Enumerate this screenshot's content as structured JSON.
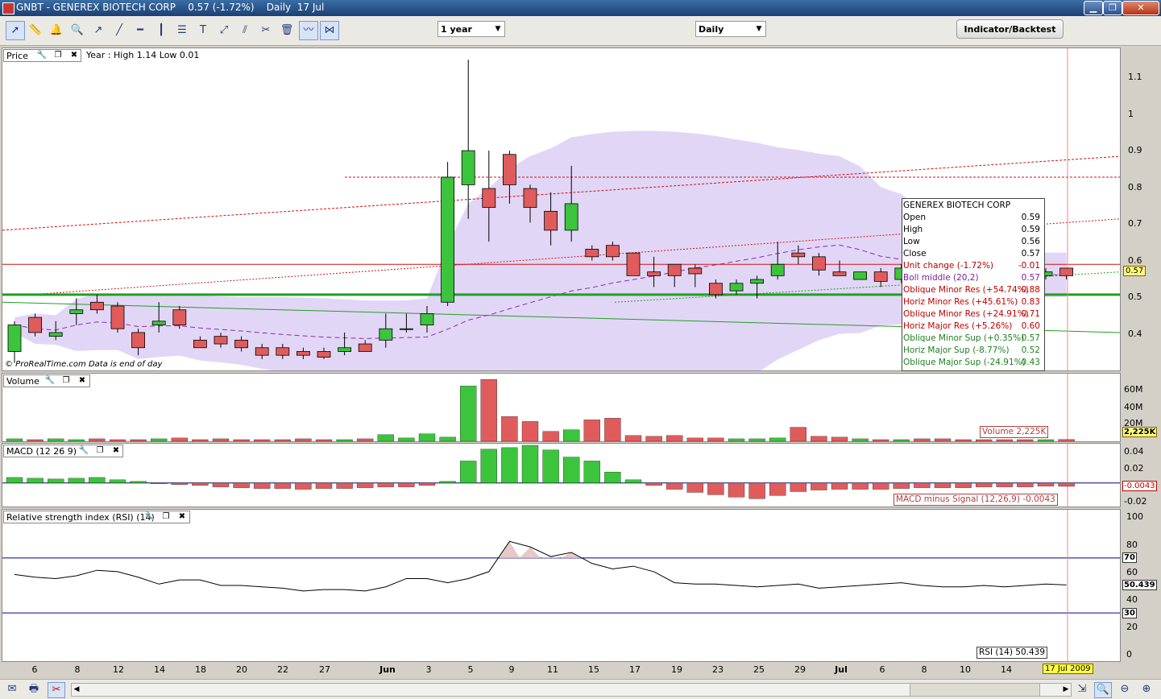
{
  "window": {
    "title": "GNBT - GENEREX BIOTECH CORP    0.57 (-1.72%)    Daily  17 Jul",
    "buttons": [
      "minimize",
      "restore",
      "close"
    ]
  },
  "toolbar": {
    "tools": [
      "pointer-icon",
      "ruler-icon",
      "alert-bell-icon",
      "zoom-icon",
      "line-icon",
      "trendline-icon",
      "horizontal-line-icon",
      "vertical-line-icon",
      "fibonacci-icon",
      "text-icon",
      "arrow-icon",
      "channel-icon",
      "tools-icon",
      "trash-icon",
      "indicator-icon",
      "auto-trend-icon"
    ],
    "period_select": "1 year",
    "interval_select": "Daily",
    "indicator_button": "Indicator/Backtest"
  },
  "price_panel": {
    "title": "Price",
    "range_text": "Year : High 1.14 Low 0.01",
    "watermark": "© ProRealTime.com  Data is end of day",
    "last_price_tag": "0.57",
    "y_ticks": [
      "1.1",
      "1",
      "0.9",
      "0.8",
      "0.7",
      "0.6",
      "0.5",
      "0.4"
    ]
  },
  "info_box": {
    "header": "GENEREX BIOTECH CORP",
    "rows": [
      {
        "label": "Open",
        "value": "0.59",
        "color": "#000000"
      },
      {
        "label": "High",
        "value": "0.59",
        "color": "#000000"
      },
      {
        "label": "Low",
        "value": "0.56",
        "color": "#000000"
      },
      {
        "label": "Close",
        "value": "0.57",
        "color": "#000000"
      },
      {
        "label": "Unit change (-1.72%)",
        "value": "-0.01",
        "color": "#b00000"
      },
      {
        "label": "Boll middle (20,2)",
        "value": "0.57",
        "color": "#7a1fa2"
      },
      {
        "label": "Oblique Minor Res (+54.74%)",
        "value": "0.88",
        "color": "#c00000"
      },
      {
        "label": "Horiz Minor Res (+45.61%)",
        "value": "0.83",
        "color": "#c00000"
      },
      {
        "label": "Oblique Minor Res (+24.91%)",
        "value": "0.71",
        "color": "#c00000"
      },
      {
        "label": "Horiz Major Res (+5.26%)",
        "value": "0.60",
        "color": "#c00000"
      },
      {
        "label": "Oblique Minor Sup (+0.35%)",
        "value": "0.57",
        "color": "#208020"
      },
      {
        "label": "Horiz Major Sup (-8.77%)",
        "value": "0.52",
        "color": "#208020"
      },
      {
        "label": "Oblique Major Sup (-24.91%)",
        "value": "0.43",
        "color": "#208020"
      }
    ]
  },
  "volume_panel": {
    "title": "Volume",
    "tag": "Volume 2,225K",
    "last_tag": "2,225K",
    "y_ticks": [
      "60M",
      "40M",
      "20M"
    ]
  },
  "macd_panel": {
    "title": "MACD (12 26 9)",
    "tag": "MACD minus Signal (12,26,9) -0.0043",
    "last_tag": "-0.0043",
    "y_ticks": [
      "0.04",
      "0.02",
      "-0.02"
    ]
  },
  "rsi_panel": {
    "title": "Relative strength index (RSI) (14)",
    "tag": "RSI (14) 50.439",
    "last_tag": "50.439",
    "level_tags": [
      "70",
      "30"
    ],
    "y_ticks": [
      "100",
      "80",
      "60",
      "40",
      "20",
      "0"
    ]
  },
  "x_axis": {
    "labels": [
      "6",
      "8",
      "12",
      "14",
      "18",
      "20",
      "22",
      "27",
      "Jun",
      "3",
      "5",
      "9",
      "11",
      "15",
      "17",
      "19",
      "23",
      "25",
      "29",
      "Jul",
      "6",
      "8",
      "10",
      "14"
    ],
    "cursor_date": "17 Jul 2009"
  },
  "chart_data": {
    "type": "candlestick",
    "title": "GNBT - GENEREX BIOTECH CORP",
    "candles": [
      {
        "o": 0.37,
        "h": 0.45,
        "l": 0.34,
        "c": 0.44
      },
      {
        "o": 0.46,
        "h": 0.47,
        "l": 0.41,
        "c": 0.42
      },
      {
        "o": 0.41,
        "h": 0.45,
        "l": 0.4,
        "c": 0.42
      },
      {
        "o": 0.47,
        "h": 0.51,
        "l": 0.44,
        "c": 0.48
      },
      {
        "o": 0.5,
        "h": 0.52,
        "l": 0.47,
        "c": 0.48
      },
      {
        "o": 0.49,
        "h": 0.5,
        "l": 0.42,
        "c": 0.43
      },
      {
        "o": 0.42,
        "h": 0.43,
        "l": 0.36,
        "c": 0.38
      },
      {
        "o": 0.44,
        "h": 0.5,
        "l": 0.42,
        "c": 0.45
      },
      {
        "o": 0.48,
        "h": 0.49,
        "l": 0.43,
        "c": 0.44
      },
      {
        "o": 0.4,
        "h": 0.41,
        "l": 0.38,
        "c": 0.38
      },
      {
        "o": 0.41,
        "h": 0.42,
        "l": 0.38,
        "c": 0.39
      },
      {
        "o": 0.4,
        "h": 0.41,
        "l": 0.37,
        "c": 0.38
      },
      {
        "o": 0.38,
        "h": 0.39,
        "l": 0.35,
        "c": 0.36
      },
      {
        "o": 0.38,
        "h": 0.39,
        "l": 0.35,
        "c": 0.36
      },
      {
        "o": 0.37,
        "h": 0.38,
        "l": 0.35,
        "c": 0.36
      },
      {
        "o": 0.37,
        "h": 0.38,
        "l": 0.35,
        "c": 0.355
      },
      {
        "o": 0.37,
        "h": 0.42,
        "l": 0.36,
        "c": 0.38
      },
      {
        "o": 0.39,
        "h": 0.4,
        "l": 0.37,
        "c": 0.37
      },
      {
        "o": 0.4,
        "h": 0.47,
        "l": 0.38,
        "c": 0.43
      },
      {
        "o": 0.43,
        "h": 0.47,
        "l": 0.42,
        "c": 0.43
      },
      {
        "o": 0.44,
        "h": 0.49,
        "l": 0.42,
        "c": 0.47
      },
      {
        "o": 0.5,
        "h": 0.87,
        "l": 0.49,
        "c": 0.83
      },
      {
        "o": 0.81,
        "h": 1.14,
        "l": 0.72,
        "c": 0.9
      },
      {
        "o": 0.8,
        "h": 0.9,
        "l": 0.66,
        "c": 0.75
      },
      {
        "o": 0.89,
        "h": 0.9,
        "l": 0.76,
        "c": 0.81
      },
      {
        "o": 0.8,
        "h": 0.81,
        "l": 0.71,
        "c": 0.75
      },
      {
        "o": 0.74,
        "h": 0.79,
        "l": 0.65,
        "c": 0.69
      },
      {
        "o": 0.69,
        "h": 0.86,
        "l": 0.66,
        "c": 0.76
      },
      {
        "o": 0.64,
        "h": 0.65,
        "l": 0.61,
        "c": 0.62
      },
      {
        "o": 0.65,
        "h": 0.66,
        "l": 0.61,
        "c": 0.62
      },
      {
        "o": 0.63,
        "h": 0.63,
        "l": 0.57,
        "c": 0.57
      },
      {
        "o": 0.58,
        "h": 0.62,
        "l": 0.54,
        "c": 0.57
      },
      {
        "o": 0.6,
        "h": 0.6,
        "l": 0.54,
        "c": 0.57
      },
      {
        "o": 0.59,
        "h": 0.6,
        "l": 0.54,
        "c": 0.575
      },
      {
        "o": 0.55,
        "h": 0.56,
        "l": 0.51,
        "c": 0.52
      },
      {
        "o": 0.53,
        "h": 0.56,
        "l": 0.52,
        "c": 0.55
      },
      {
        "o": 0.55,
        "h": 0.57,
        "l": 0.51,
        "c": 0.56
      },
      {
        "o": 0.57,
        "h": 0.66,
        "l": 0.56,
        "c": 0.6
      },
      {
        "o": 0.63,
        "h": 0.65,
        "l": 0.6,
        "c": 0.62
      },
      {
        "o": 0.62,
        "h": 0.63,
        "l": 0.57,
        "c": 0.585
      },
      {
        "o": 0.58,
        "h": 0.61,
        "l": 0.57,
        "c": 0.57
      },
      {
        "o": 0.56,
        "h": 0.58,
        "l": 0.56,
        "c": 0.58
      },
      {
        "o": 0.58,
        "h": 0.59,
        "l": 0.54,
        "c": 0.555
      },
      {
        "o": 0.56,
        "h": 0.6,
        "l": 0.55,
        "c": 0.59
      },
      {
        "o": 0.58,
        "h": 0.59,
        "l": 0.56,
        "c": 0.57
      },
      {
        "o": 0.58,
        "h": 0.59,
        "l": 0.56,
        "c": 0.57
      },
      {
        "o": 0.58,
        "h": 0.59,
        "l": 0.56,
        "c": 0.57
      },
      {
        "o": 0.58,
        "h": 0.59,
        "l": 0.56,
        "c": 0.57
      },
      {
        "o": 0.58,
        "h": 0.59,
        "l": 0.56,
        "c": 0.57
      },
      {
        "o": 0.58,
        "h": 0.59,
        "l": 0.56,
        "c": 0.57
      },
      {
        "o": 0.57,
        "h": 0.59,
        "l": 0.56,
        "c": 0.58
      },
      {
        "o": 0.59,
        "h": 0.59,
        "l": 0.56,
        "c": 0.57
      }
    ],
    "volume_millions": [
      3,
      2,
      3,
      2,
      3,
      2,
      2,
      3,
      4,
      2,
      3,
      2,
      2,
      2,
      3,
      2,
      2,
      3,
      8,
      4,
      9,
      5,
      67,
      75,
      30,
      24,
      12,
      14,
      26,
      28,
      7,
      6,
      7,
      4,
      4,
      3,
      3,
      4,
      17,
      6,
      5,
      3,
      2,
      2,
      3,
      3,
      2,
      2,
      2,
      2,
      2,
      2.2
    ],
    "macd_hist": [
      0.007,
      0.006,
      0.005,
      0.006,
      0.007,
      0.004,
      0.002,
      -0.001,
      -0.002,
      -0.003,
      -0.005,
      -0.006,
      -0.007,
      -0.007,
      -0.008,
      -0.007,
      -0.007,
      -0.006,
      -0.005,
      -0.005,
      -0.003,
      0.002,
      0.028,
      0.043,
      0.045,
      0.048,
      0.042,
      0.033,
      0.028,
      0.014,
      0.004,
      -0.003,
      -0.008,
      -0.012,
      -0.015,
      -0.018,
      -0.02,
      -0.016,
      -0.011,
      -0.009,
      -0.008,
      -0.008,
      -0.008,
      -0.007,
      -0.006,
      -0.006,
      -0.006,
      -0.005,
      -0.005,
      -0.005,
      -0.004,
      -0.0043
    ],
    "rsi": [
      58,
      56,
      55,
      57,
      61,
      60,
      56,
      51,
      54,
      54,
      50,
      50,
      49,
      48,
      46,
      47,
      47,
      46,
      49,
      55,
      55,
      52,
      55,
      60,
      82,
      78,
      71,
      74,
      66,
      62,
      64,
      60,
      52,
      51,
      51,
      50,
      49,
      50,
      51,
      48,
      49,
      50,
      51,
      52,
      50,
      49,
      49,
      50,
      49,
      50,
      51,
      50.4
    ],
    "rsi_levels": [
      70,
      30
    ],
    "ylim_price": [
      0.32,
      1.17
    ],
    "ylim_volume": [
      0,
      80
    ],
    "ylim_macd": [
      -0.03,
      0.05
    ],
    "ylim_rsi": [
      -5,
      105
    ],
    "colors": {
      "up": "#3cc43c",
      "down": "#e05c5c",
      "band": "#e2d6f7",
      "boll_mid": "#8a2ab0",
      "support": "#1fa01f",
      "resistance": "#d01010"
    }
  }
}
